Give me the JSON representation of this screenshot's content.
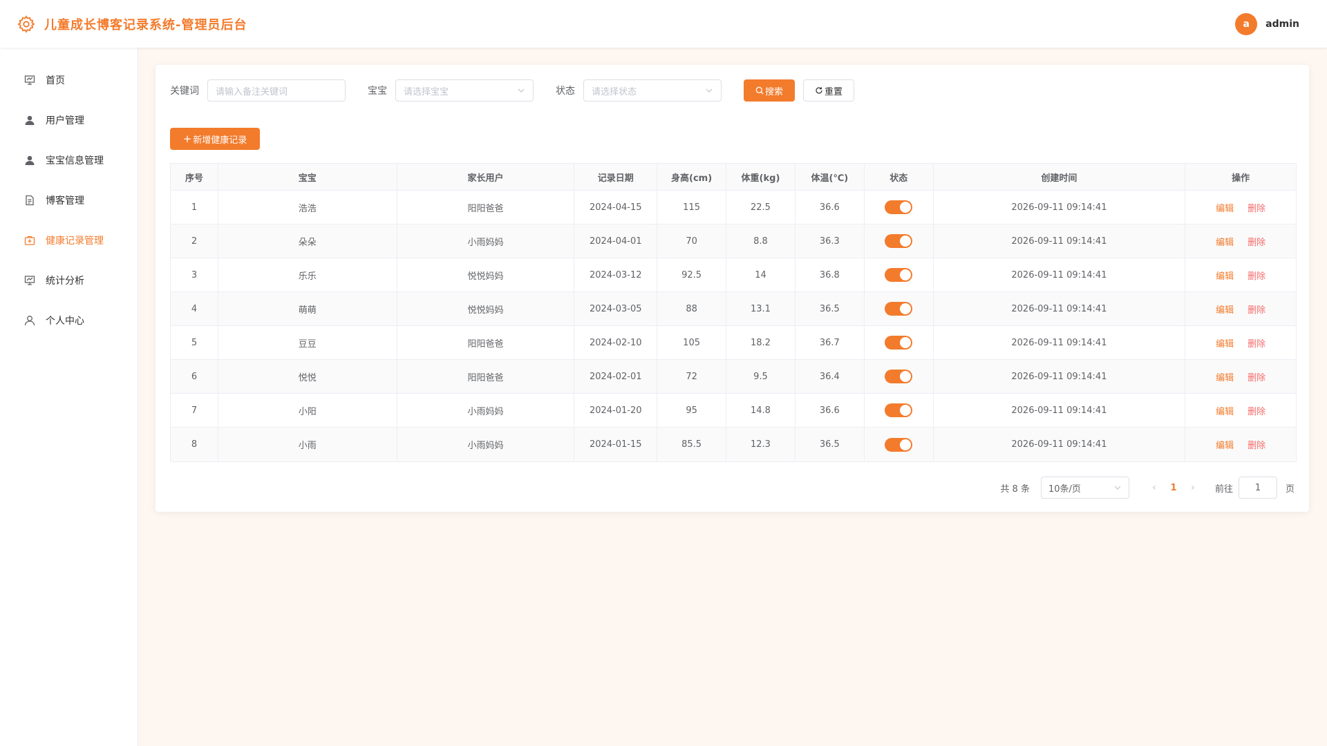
{
  "app": {
    "title": "儿童成长博客记录系统-管理员后台",
    "brand_color": "#f37b2c"
  },
  "user": {
    "avatar_letter": "a",
    "name": "admin"
  },
  "sidebar": {
    "items": [
      {
        "label": "首页",
        "icon": "presentation-icon",
        "active": false
      },
      {
        "label": "用户管理",
        "icon": "user-icon",
        "active": false
      },
      {
        "label": "宝宝信息管理",
        "icon": "user-icon",
        "active": false
      },
      {
        "label": "博客管理",
        "icon": "document-icon",
        "active": false
      },
      {
        "label": "健康记录管理",
        "icon": "medical-kit-icon",
        "active": true
      },
      {
        "label": "统计分析",
        "icon": "presentation-icon",
        "active": false
      },
      {
        "label": "个人中心",
        "icon": "user-outline-icon",
        "active": false
      }
    ]
  },
  "filters": {
    "keyword_label": "关键词",
    "keyword_placeholder": "请输入备注关键词",
    "baby_label": "宝宝",
    "baby_placeholder": "请选择宝宝",
    "status_label": "状态",
    "status_placeholder": "请选择状态",
    "search_label": "搜索",
    "reset_label": "重置"
  },
  "add_button_label": "新增健康记录",
  "table": {
    "headers": [
      "序号",
      "宝宝",
      "家长用户",
      "记录日期",
      "身高(cm)",
      "体重(kg)",
      "体温(℃)",
      "状态",
      "创建时间",
      "操作"
    ],
    "edit_label": "编辑",
    "delete_label": "删除",
    "rows": [
      {
        "no": "1",
        "baby": "浩浩",
        "parent": "阳阳爸爸",
        "date": "2024-04-15",
        "height": "115",
        "weight": "22.5",
        "temp": "36.6",
        "status": true,
        "created": "2026-09-11 09:14:41"
      },
      {
        "no": "2",
        "baby": "朵朵",
        "parent": "小雨妈妈",
        "date": "2024-04-01",
        "height": "70",
        "weight": "8.8",
        "temp": "36.3",
        "status": true,
        "created": "2026-09-11 09:14:41"
      },
      {
        "no": "3",
        "baby": "乐乐",
        "parent": "悦悦妈妈",
        "date": "2024-03-12",
        "height": "92.5",
        "weight": "14",
        "temp": "36.8",
        "status": true,
        "created": "2026-09-11 09:14:41"
      },
      {
        "no": "4",
        "baby": "萌萌",
        "parent": "悦悦妈妈",
        "date": "2024-03-05",
        "height": "88",
        "weight": "13.1",
        "temp": "36.5",
        "status": true,
        "created": "2026-09-11 09:14:41"
      },
      {
        "no": "5",
        "baby": "豆豆",
        "parent": "阳阳爸爸",
        "date": "2024-02-10",
        "height": "105",
        "weight": "18.2",
        "temp": "36.7",
        "status": true,
        "created": "2026-09-11 09:14:41"
      },
      {
        "no": "6",
        "baby": "悦悦",
        "parent": "阳阳爸爸",
        "date": "2024-02-01",
        "height": "72",
        "weight": "9.5",
        "temp": "36.4",
        "status": true,
        "created": "2026-09-11 09:14:41"
      },
      {
        "no": "7",
        "baby": "小阳",
        "parent": "小雨妈妈",
        "date": "2024-01-20",
        "height": "95",
        "weight": "14.8",
        "temp": "36.6",
        "status": true,
        "created": "2026-09-11 09:14:41"
      },
      {
        "no": "8",
        "baby": "小雨",
        "parent": "小雨妈妈",
        "date": "2024-01-15",
        "height": "85.5",
        "weight": "12.3",
        "temp": "36.5",
        "status": true,
        "created": "2026-09-11 09:14:41"
      }
    ]
  },
  "pagination": {
    "total_text": "共 8 条",
    "page_size": "10条/页",
    "current_page": "1",
    "goto_label": "前往",
    "jump_value": "1",
    "page_suffix": "页"
  }
}
